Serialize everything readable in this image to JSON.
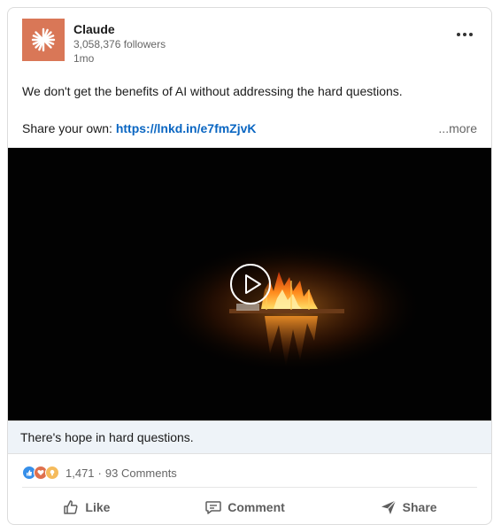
{
  "author": {
    "name": "Claude",
    "followers": "3,058,376 followers",
    "time": "1mo"
  },
  "post": {
    "text": "We don't get the benefits of AI without addressing the hard questions.",
    "share_prefix": "Share your own: ",
    "link": "https://lnkd.in/e7fmZjvK",
    "see_more": "...more"
  },
  "video": {
    "caption": "There's hope in hard questions."
  },
  "social": {
    "reactions_count": "1,471",
    "separator": "·",
    "comments": "93 Comments",
    "reaction_icons": [
      "like-reaction-icon",
      "love-reaction-icon",
      "insightful-reaction-icon"
    ]
  },
  "actions": {
    "like": "Like",
    "comment": "Comment",
    "share": "Share"
  },
  "colors": {
    "brand": "#d97757",
    "link": "#0a66c2",
    "caption_bg": "#eef3f8"
  }
}
